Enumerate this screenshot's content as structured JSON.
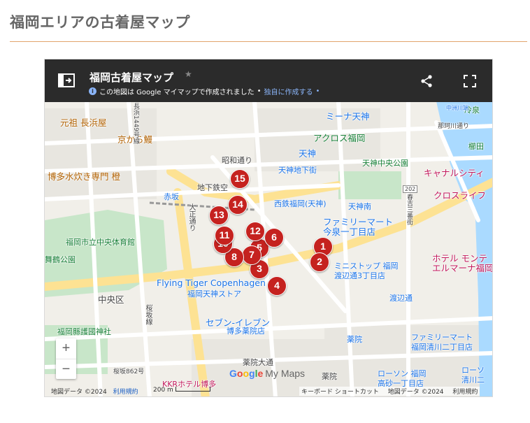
{
  "page": {
    "title": "福岡エリアの古着屋マップ"
  },
  "map": {
    "title": "福岡古着屋マップ",
    "subtitle_prefix": "この地図は Google マイマップで作成されました",
    "subtitle_link": "独自に作成する",
    "footer": {
      "data_left": "地図データ ©2024",
      "terms": "利用規約",
      "scale": "200 m",
      "shortcuts": "キーボード ショートカット",
      "data_right": "地図データ ©2024",
      "terms_right": "利用規約"
    },
    "labels": {
      "motoso": "元祖 長浜屋",
      "kyokaraunagi": "京から鰻",
      "hakata_mizutaki": "博多水炊き専門 橙",
      "showa_dori": "昭和通り",
      "tenjin_chikatetsu": "地下鉄空",
      "akasaka": "赤坂",
      "taisho_dori": "大正通り",
      "taiikukan": "福岡市立中央体育館",
      "maizuru": "舞鶴公園",
      "chuo_ku": "中央区",
      "gokoku": "福岡縣護國神社",
      "sakurazaka_line": "桜坂線",
      "sakurazaka862": "桜坂862号",
      "flying_tiger": "Flying Tiger Copenhagen",
      "tenjin_store": "福岡天神ストア",
      "seven_eleven": "セブン-イレブン",
      "hakata_yakuin": "博多薬院店",
      "yakuin_odori": "薬院大通",
      "yakuin": "薬院",
      "yakuin2": "薬院",
      "nagahama": "長浜1449号線",
      "mina_tenjin": "ミーナ天神",
      "tenjin": "天神",
      "tenjin_chikagai": "天神地下街",
      "acros": "アクロス福岡",
      "tenjin_chuo": "天神中央公園",
      "nishitetsu": "西鉄福岡(天神)",
      "tenjin_minami": "天神南",
      "familymart1": "ファミリーマート",
      "imaizumi": "今泉一丁目店",
      "ministop": "ミニストップ 福岡",
      "watanabe": "渡辺通3丁目店",
      "watanabe_dori": "渡辺通",
      "yakuin_station": "薬院",
      "familymart2": "ファミリーマート",
      "kiyokawa": "福岡清川二丁目店",
      "lawson": "ローソン 福岡",
      "takasago": "高砂一丁目店",
      "lawson2": "ローソ",
      "kiyokawa2": "清川二",
      "kanal": "キャナルシティ",
      "cross_life": "クロスライフ",
      "hotel": "ホテル モンテ",
      "elmarna": "エルマーナ福岡",
      "shimo_route": "那珂川通り",
      "nishi_route": "春吉三番街",
      "kushida": "櫛田",
      "kashiwa": "冷泉",
      "nakasu": "中洲川端",
      "route_202": "202",
      "kkr": "KKRホテル博多"
    }
  },
  "pins": [
    {
      "id": "pin-1",
      "label": "1"
    },
    {
      "id": "pin-2",
      "label": "2"
    },
    {
      "id": "pin-3",
      "label": "3"
    },
    {
      "id": "pin-4",
      "label": "4"
    },
    {
      "id": "pin-5",
      "label": "5"
    },
    {
      "id": "pin-6",
      "label": "6"
    },
    {
      "id": "pin-7",
      "label": "7"
    },
    {
      "id": "pin-8",
      "label": "8"
    },
    {
      "id": "pin-10",
      "label": "10"
    },
    {
      "id": "pin-11",
      "label": "11"
    },
    {
      "id": "pin-12",
      "label": "12"
    },
    {
      "id": "pin-13",
      "label": "13"
    },
    {
      "id": "pin-14",
      "label": "14"
    },
    {
      "id": "pin-15",
      "label": "15"
    }
  ],
  "controls": {
    "zoom_in": "+",
    "zoom_out": "−"
  }
}
